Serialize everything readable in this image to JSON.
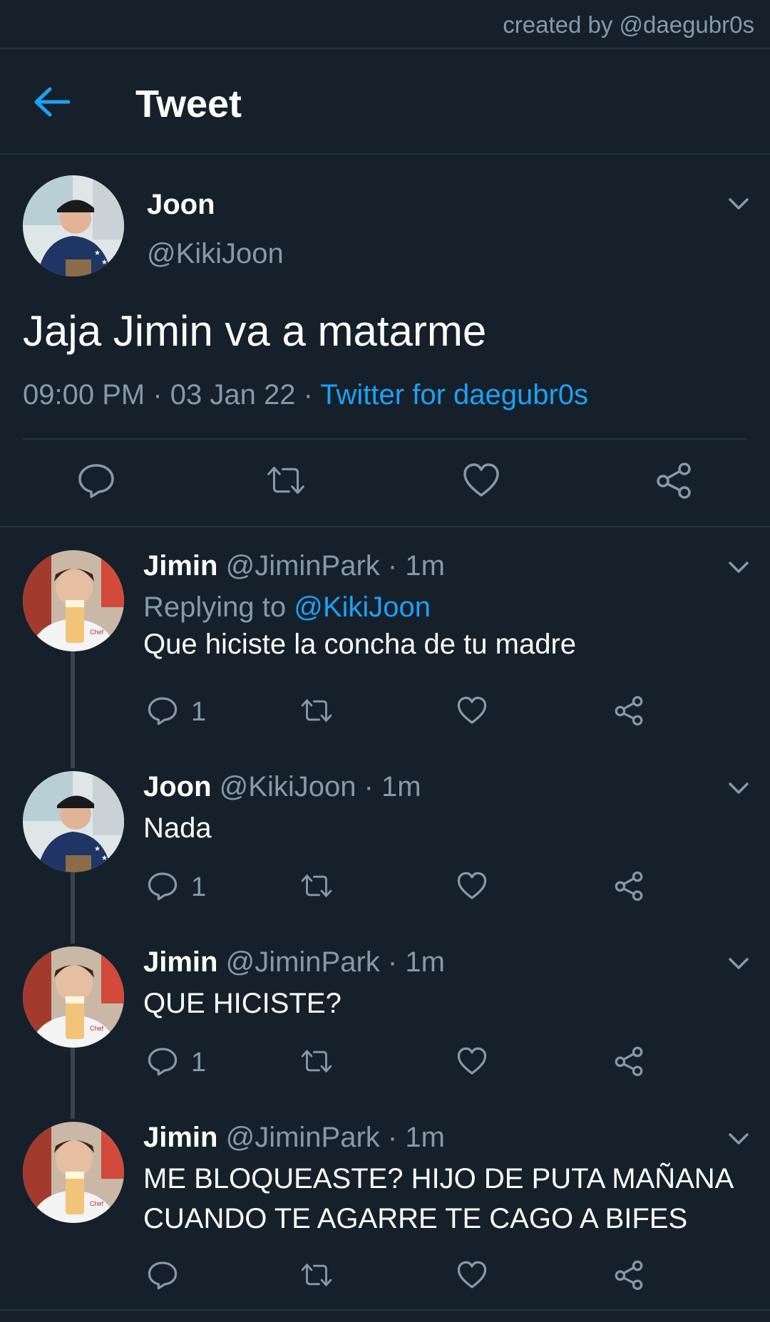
{
  "credit": "created by @daegubr0s",
  "header": {
    "title": "Tweet",
    "back_icon": "arrow-left-icon"
  },
  "colors": {
    "background": "#15202b",
    "accent": "#1da1f2",
    "muted": "#8899a6",
    "divider": "#253341"
  },
  "main_tweet": {
    "name": "Joon",
    "handle": "@KikiJoon",
    "text": "Jaja Jimin va a matarme",
    "time": "09:00 PM",
    "date": "03 Jan 22",
    "source": "Twitter for daegubr0s",
    "sep": " · ",
    "actions": [
      "reply-icon",
      "retweet-icon",
      "like-icon",
      "share-icon"
    ]
  },
  "replies": [
    {
      "name": "Jimin",
      "handle": "@JiminPark",
      "time": "1m",
      "replying_prefix": "Replying to ",
      "replying_to": "@KikiJoon",
      "text": "Que hiciste la concha de tu madre",
      "reply_count": "1"
    },
    {
      "name": "Joon",
      "handle": "@KikiJoon",
      "time": "1m",
      "text": "Nada",
      "reply_count": "1"
    },
    {
      "name": "Jimin",
      "handle": "@JiminPark",
      "time": "1m",
      "text": "QUE HICISTE?",
      "reply_count": "1"
    },
    {
      "name": "Jimin",
      "handle": "@JiminPark",
      "time": "1m",
      "text": "ME BLOQUEASTE? HIJO DE PUTA MAÑANA CUANDO TE AGARRE TE CAGO A BIFES",
      "reply_count": ""
    }
  ]
}
